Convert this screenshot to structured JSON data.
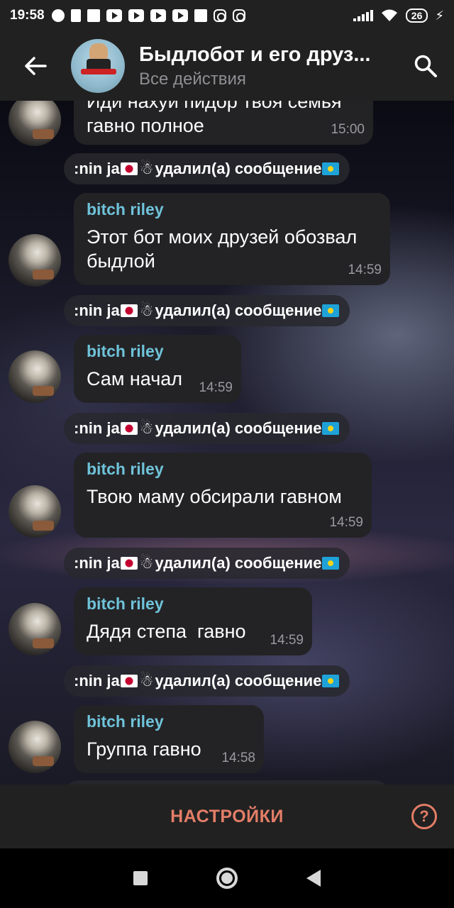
{
  "status_bar": {
    "time": "19:58",
    "battery": "26"
  },
  "header": {
    "title": "Быдлобот и его друз...",
    "subtitle": "Все действия"
  },
  "first_message": {
    "text": "Иди нахуй пидор твоя семья гавно полное",
    "time": "15:00"
  },
  "service_message": {
    "user": ":nin ja",
    "action": "удалил(а) сообщение"
  },
  "messages": [
    {
      "sender": "bitch riley",
      "text": "Этот бот моих друзей обозвал быдлой",
      "time": "14:59"
    },
    {
      "sender": "bitch riley",
      "text": "Сам начал",
      "time": "14:59"
    },
    {
      "sender": "bitch riley",
      "text": "Твою маму обсирали гавном",
      "time": "14:59"
    },
    {
      "sender": "bitch riley",
      "text": "Дядя степа  гавно",
      "time": "14:59"
    },
    {
      "sender": "bitch riley",
      "text": "Группа гавно",
      "time": "14:58"
    }
  ],
  "bottom_bar": {
    "settings_label": "НАСТРОЙКИ",
    "help_label": "?"
  },
  "colors": {
    "accent": "#e37d67",
    "sender": "#6fc3d9",
    "bar": "#212121"
  }
}
